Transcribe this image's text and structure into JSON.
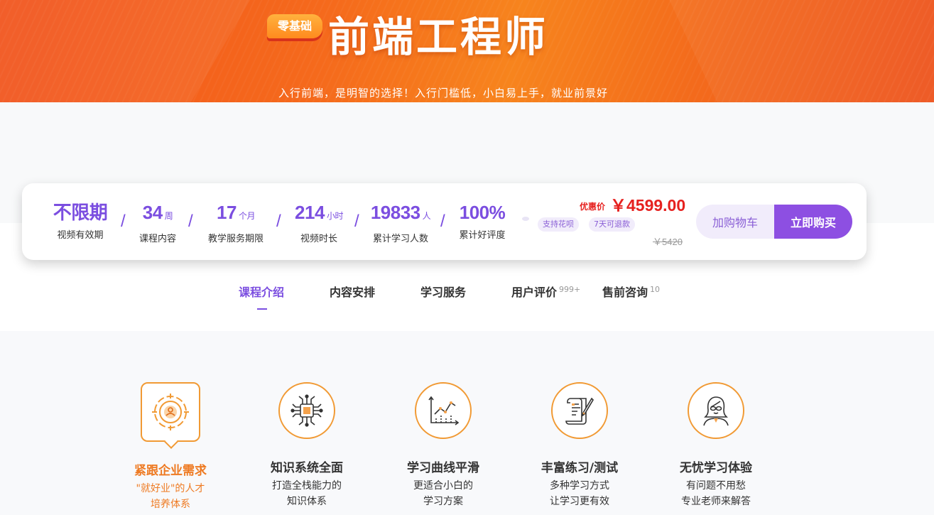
{
  "hero": {
    "badge": "零基础",
    "title": "前端工程师",
    "tagline": "入行前端，是明智的选择！入行门槛低，小白易上手，就业前景好",
    "ghost_line1": "",
    "ghost_line2": ""
  },
  "stats": [
    {
      "value": "不限期",
      "unit": "",
      "label": "视频有效期"
    },
    {
      "value": "34",
      "unit": "周",
      "label": "课程内容"
    },
    {
      "value": "17",
      "unit": "个月",
      "label": "教学服务期限"
    },
    {
      "value": "214",
      "unit": "小时",
      "label": "视频时长"
    },
    {
      "value": "19833",
      "unit": "人",
      "label": "累计学习人数"
    },
    {
      "value": "100%",
      "unit": "",
      "label": "累计好评度"
    }
  ],
  "stat_separator": "/",
  "pricing": {
    "label": "优惠价",
    "price": "￥4599.00",
    "original": "￥5420",
    "tags": [
      "支持花呗",
      "7天可退款"
    ]
  },
  "buttons": {
    "cart": "加购物车",
    "buy": "立即购买"
  },
  "tabs": [
    {
      "label": "课程介绍",
      "count": ""
    },
    {
      "label": "内容安排",
      "count": ""
    },
    {
      "label": "学习服务",
      "count": ""
    },
    {
      "label": "用户评价",
      "count": "999+"
    },
    {
      "label": "售前咨询",
      "count": "10"
    }
  ],
  "features": [
    {
      "icon": "target-user-icon",
      "title": "紧跟企业需求",
      "line1": "\"就好业\"的人才",
      "line2": "培养体系"
    },
    {
      "icon": "chip-network-icon",
      "title": "知识系统全面",
      "line1": "打造全栈能力的",
      "line2": "知识体系"
    },
    {
      "icon": "chart-curve-icon",
      "title": "学习曲线平滑",
      "line1": "更适合小白的",
      "line2": "学习方案"
    },
    {
      "icon": "document-pen-icon",
      "title": "丰富练习/测试",
      "line1": "多种学习方式",
      "line2": "让学习更有效"
    },
    {
      "icon": "teacher-avatar-icon",
      "title": "无忧学习体验",
      "line1": "有问题不用愁",
      "line2": "专业老师来解答"
    }
  ],
  "colors": {
    "brand_purple": "#8d4fe2",
    "hero_orange": "#f56a1c",
    "price_red": "#e6211f",
    "feature_orange": "#ee7a22"
  }
}
